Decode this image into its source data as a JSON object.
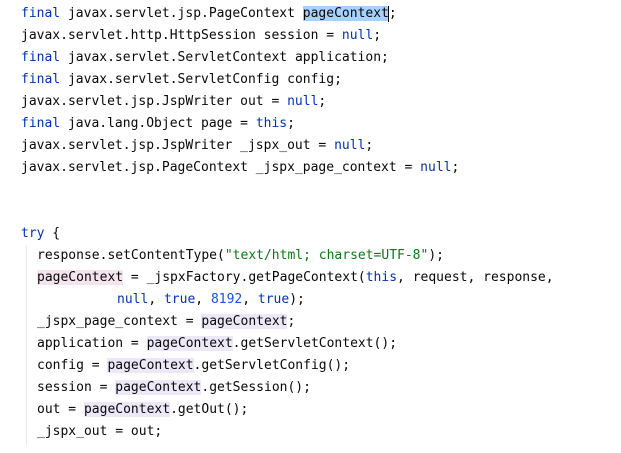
{
  "editor": {
    "lines": {
      "l1": {
        "kw_final": "final",
        "type": " javax.servlet.jsp.PageContext ",
        "var": "pageContext",
        "end": ";"
      },
      "l2": {
        "text": "javax.servlet.http.HttpSession session = ",
        "kw_null": "null",
        "end": ";"
      },
      "l3": {
        "kw_final": "final",
        "text": " javax.servlet.ServletContext application;"
      },
      "l4": {
        "kw_final": "final",
        "text": " javax.servlet.ServletConfig config;"
      },
      "l5": {
        "text": "javax.servlet.jsp.JspWriter out = ",
        "kw_null": "null",
        "end": ";"
      },
      "l6": {
        "kw_final": "final",
        "text": " java.lang.Object page = ",
        "kw_this": "this",
        "end": ";"
      },
      "l7": {
        "text": "javax.servlet.jsp.JspWriter _jspx_out = ",
        "kw_null": "null",
        "end": ";"
      },
      "l8": {
        "text": "javax.servlet.jsp.PageContext _jspx_page_context = ",
        "kw_null": "null",
        "end": ";"
      },
      "l9": {
        "kw_try": "try",
        "end": " {"
      },
      "l10": {
        "text": "response.setContentType(",
        "str": "\"text/html; charset=UTF-8\"",
        "end": ");"
      },
      "l11": {
        "var": "pageContext",
        "text": " = _jspxFactory.getPageContext(",
        "kw_this": "this",
        "end": ", request, response,"
      },
      "l12": {
        "kw_null": "null",
        "sep1": ", ",
        "kw_true1": "true",
        "sep2": ", ",
        "num": "8192",
        "sep3": ", ",
        "kw_true2": "true",
        "end": ");"
      },
      "l13": {
        "text": "_jspx_page_context = ",
        "var": "pageContext",
        "end": ";"
      },
      "l14": {
        "text": "application = ",
        "var": "pageContext",
        "end": ".getServletContext();"
      },
      "l15": {
        "text": "config = ",
        "var": "pageContext",
        "end": ".getServletConfig();"
      },
      "l16": {
        "text": "session = ",
        "var": "pageContext",
        "end": ".getSession();"
      },
      "l17": {
        "text": "out = ",
        "var": "pageContext",
        "end": ".getOut();"
      },
      "l18": {
        "text": "_jspx_out = out;"
      }
    }
  },
  "colors": {
    "keyword": "#0033b3",
    "string": "#067d17",
    "number": "#1750eb",
    "default": "#080808",
    "usage_highlight": "#ede8f8",
    "selection": "#a6d2ff",
    "write_highlight": "#f5e3ee"
  }
}
